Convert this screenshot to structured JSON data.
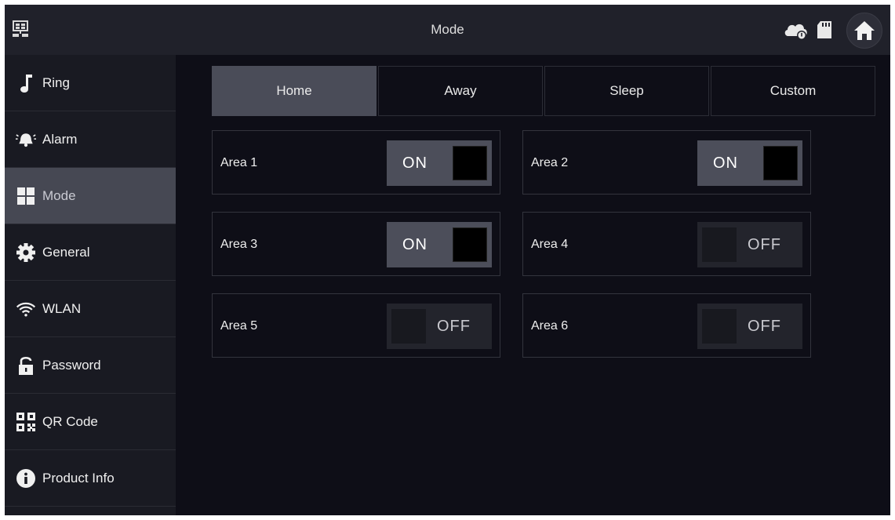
{
  "header": {
    "title": "Mode",
    "left_icon": "network-icon",
    "right_icons": [
      "cloud-icon",
      "sd-card-icon",
      "home-icon"
    ]
  },
  "sidebar": {
    "items": [
      {
        "label": "Ring",
        "icon": "music-note-icon"
      },
      {
        "label": "Alarm",
        "icon": "alarm-bell-icon"
      },
      {
        "label": "Mode",
        "icon": "grid-icon",
        "active": true
      },
      {
        "label": "General",
        "icon": "gear-icon"
      },
      {
        "label": "WLAN",
        "icon": "wifi-icon"
      },
      {
        "label": "Password",
        "icon": "lock-icon"
      },
      {
        "label": "QR Code",
        "icon": "qr-code-icon"
      },
      {
        "label": "Product Info",
        "icon": "info-icon"
      }
    ]
  },
  "tabs": [
    {
      "label": "Home",
      "active": true
    },
    {
      "label": "Away"
    },
    {
      "label": "Sleep"
    },
    {
      "label": "Custom"
    }
  ],
  "areas": [
    {
      "label": "Area 1",
      "state": "ON"
    },
    {
      "label": "Area 2",
      "state": "ON"
    },
    {
      "label": "Area 3",
      "state": "ON"
    },
    {
      "label": "Area 4",
      "state": "OFF"
    },
    {
      "label": "Area 5",
      "state": "OFF"
    },
    {
      "label": "Area 6",
      "state": "OFF"
    }
  ],
  "colors": {
    "background": "#0e0e17",
    "sidebar": "#191a22",
    "active_item": "#464853",
    "toggle_on": "#4c4e5a",
    "toggle_off": "#23242c"
  }
}
